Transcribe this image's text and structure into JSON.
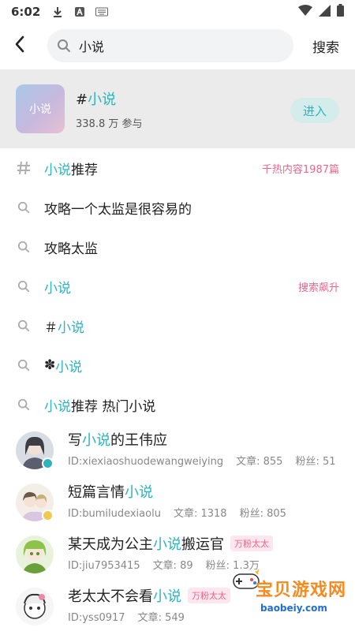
{
  "status_bar": {
    "time": "6:02",
    "icons": [
      "download-icon",
      "accessibility-icon",
      "keyboard-icon"
    ],
    "right_icons": [
      "wifi-icon",
      "signal-icon",
      "battery-icon"
    ]
  },
  "header": {
    "back_icon": "back-arrow-icon",
    "search_value": "小说",
    "search_button": "搜索"
  },
  "topic": {
    "thumb_label": "小说",
    "title_prefix": "#",
    "title_keyword": "小说",
    "participants": "338.8 万 参与",
    "enter_label": "进入"
  },
  "suggestions": [
    {
      "icon": "hashtag-icon",
      "highlight": "小说",
      "rest": "推荐",
      "badge": "千热内容1987篇"
    },
    {
      "icon": "search-icon",
      "plain": "攻略一个太监是很容易的"
    },
    {
      "icon": "search-icon",
      "plain": "攻略太监"
    },
    {
      "icon": "search-icon",
      "highlight": "小说",
      "badge": "搜索飙升"
    },
    {
      "icon": "search-icon",
      "prefix": "＃",
      "highlight": "小说"
    },
    {
      "icon": "search-icon",
      "prefix": "✽",
      "highlight": "小说"
    },
    {
      "icon": "search-icon",
      "highlight": "小说",
      "rest": "推荐 热门小说"
    }
  ],
  "users": [
    {
      "pre": "写",
      "kw": "小说",
      "post": "的王伟应",
      "id": "ID:xiexiaoshuodewangweiying",
      "articles": "文章: 855",
      "fans": "粉丝: 51",
      "tag": "",
      "badge_color": "#2bb5bd"
    },
    {
      "pre": "短篇言情",
      "kw": "小说",
      "post": "",
      "id": "ID:bumiludexiaolu",
      "articles": "文章: 1318",
      "fans": "粉丝: 805",
      "tag": "",
      "badge_color": "#f2c94c"
    },
    {
      "pre": "某天成为公主",
      "kw": "小说",
      "post": "搬运官",
      "id": "ID:jiu7953415",
      "articles": "文章: 89",
      "fans": "粉丝: 1.3万",
      "tag": "万粉太太",
      "badge_color": ""
    },
    {
      "pre": "老太太不会看",
      "kw": "小说",
      "post": "",
      "id": "ID:yss0917",
      "articles": "文章: 549",
      "fans": "",
      "tag": "万粉太太",
      "badge_color": ""
    }
  ],
  "watermark": {
    "title": "宝贝游戏网",
    "url": "baobeiy.com"
  },
  "colors": {
    "accent": "#2bb5bd",
    "badge_pink": "#e8678e",
    "topic_bg": "#ebebeb"
  }
}
